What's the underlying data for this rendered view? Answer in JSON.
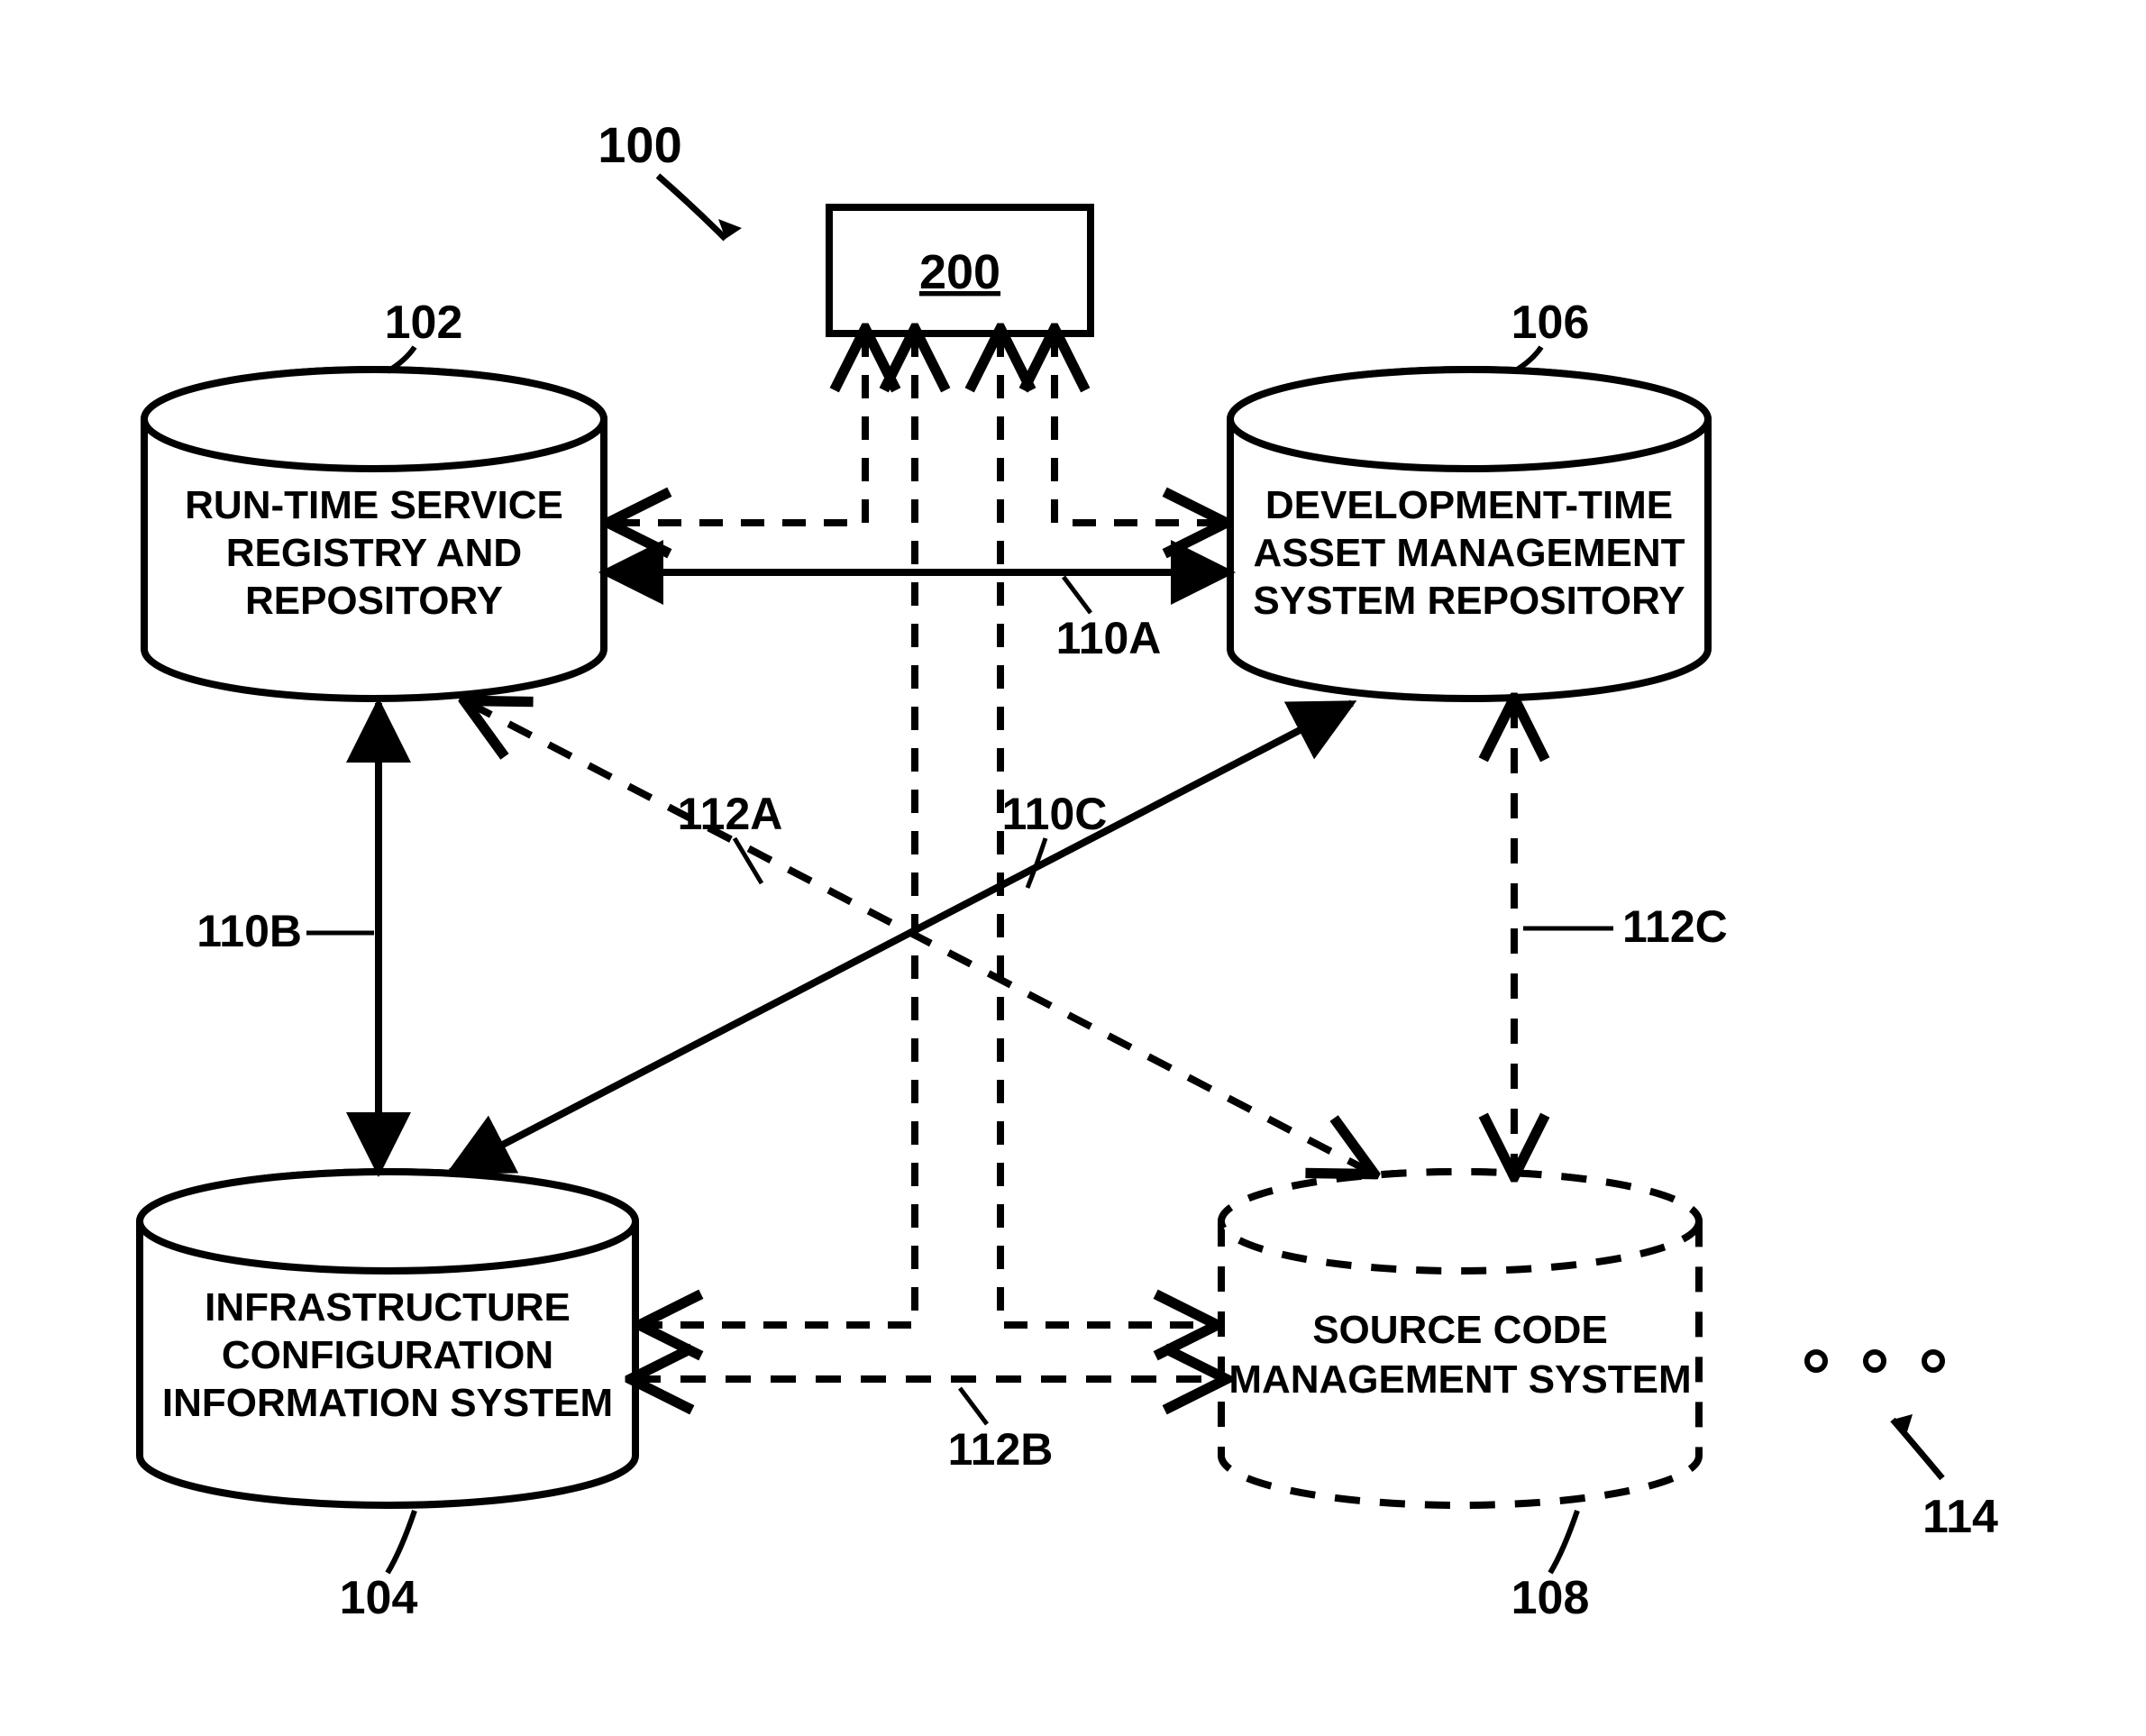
{
  "diagram": {
    "overall_ref": "100",
    "central_box": "200",
    "nodes": {
      "n102": {
        "ref": "102",
        "text": [
          "RUN-TIME SERVICE",
          "REGISTRY AND",
          "REPOSITORY"
        ]
      },
      "n104": {
        "ref": "104",
        "text": [
          "INFRASTRUCTURE",
          "CONFIGURATION",
          "INFORMATION SYSTEM"
        ]
      },
      "n106": {
        "ref": "106",
        "text": [
          "DEVELOPMENT-TIME",
          "ASSET MANAGEMENT",
          "SYSTEM REPOSITORY"
        ]
      },
      "n108": {
        "ref": "108",
        "text": [
          "SOURCE CODE",
          "MANAGEMENT SYSTEM"
        ]
      },
      "n114": {
        "ref": "114"
      }
    },
    "connectors": {
      "c110a": "110A",
      "c110b": "110B",
      "c110c": "110C",
      "c112a": "112A",
      "c112b": "112B",
      "c112c": "112C"
    }
  }
}
